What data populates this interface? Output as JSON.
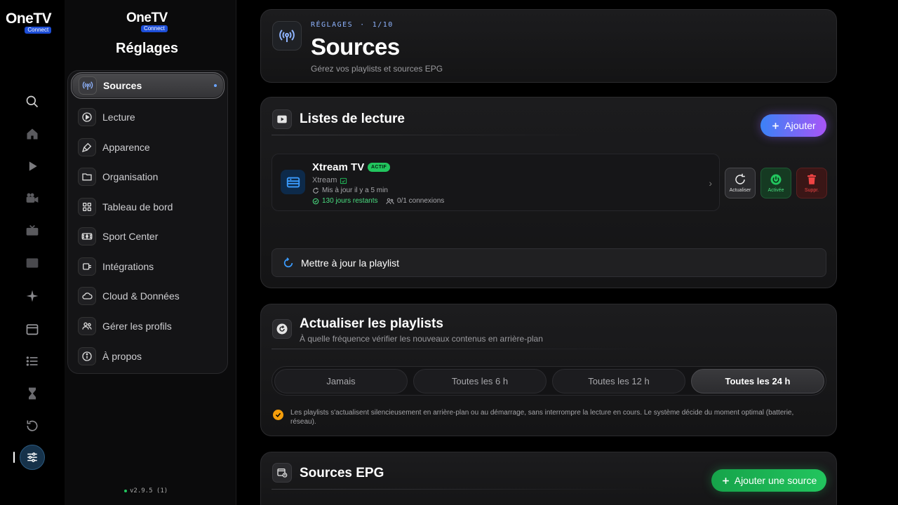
{
  "app": {
    "logo_word": "OneTV",
    "logo_badge": "Connect",
    "version": "v2.9.5 (1)"
  },
  "rail": {
    "items": [
      "search-icon",
      "home-icon",
      "play-icon",
      "movie-camera-icon",
      "tv-icon",
      "film-icon",
      "sparkle-icon",
      "calendar-icon",
      "list-icon",
      "hourglass-icon",
      "history-icon",
      "settings-sliders-icon"
    ],
    "active": "settings-sliders-icon"
  },
  "settings": {
    "title": "Réglages",
    "menu": [
      {
        "label": "Sources",
        "icon": "antenna-icon",
        "active": true
      },
      {
        "label": "Lecture",
        "icon": "play-circle-icon"
      },
      {
        "label": "Apparence",
        "icon": "paint-brush-icon"
      },
      {
        "label": "Organisation",
        "icon": "folder-icon"
      },
      {
        "label": "Tableau de bord",
        "icon": "grid-icon"
      },
      {
        "label": "Sport Center",
        "icon": "stadium-icon"
      },
      {
        "label": "Intégrations",
        "icon": "plug-icon"
      },
      {
        "label": "Cloud & Données",
        "icon": "cloud-icon"
      },
      {
        "label": "Gérer les profils",
        "icon": "users-icon"
      },
      {
        "label": "À propos",
        "icon": "info-icon"
      }
    ]
  },
  "header": {
    "eyebrow": "RÉGLAGES",
    "separator": "·",
    "step": "1/10",
    "title": "Sources",
    "subtitle": "Gérez vos playlists et sources EPG"
  },
  "playlists": {
    "title": "Listes de lecture",
    "add_label": "Ajouter",
    "item": {
      "name": "Xtream TV",
      "badge": "ACTIF",
      "type": "Xtream",
      "updated": "Mis à jour il y a 5 min",
      "days_left": "130 jours restants",
      "connections": "0/1 connexions"
    },
    "actions": {
      "refresh": "Actualiser",
      "active": "Activée",
      "delete": "Suppr."
    },
    "update_label": "Mettre à jour la playlist"
  },
  "refresh": {
    "title": "Actualiser les playlists",
    "subtitle": "À quelle fréquence vérifier les nouveaux contenus en arrière-plan",
    "options": [
      "Jamais",
      "Toutes les 6 h",
      "Toutes les 12 h",
      "Toutes les 24 h"
    ],
    "selected": "Toutes les 24 h",
    "note": "Les playlists s'actualisent silencieusement en arrière-plan ou au démarrage, sans interrompre la lecture en cours. Le système décide du moment optimal (batterie, réseau)."
  },
  "epg": {
    "title": "Sources EPG",
    "add_label": "Ajouter une source"
  },
  "colors": {
    "accent_blue": "#3b82f6",
    "accent_purple": "#a855f7",
    "success": "#22c55e",
    "danger": "#ef4444",
    "warning": "#f59e0b"
  }
}
